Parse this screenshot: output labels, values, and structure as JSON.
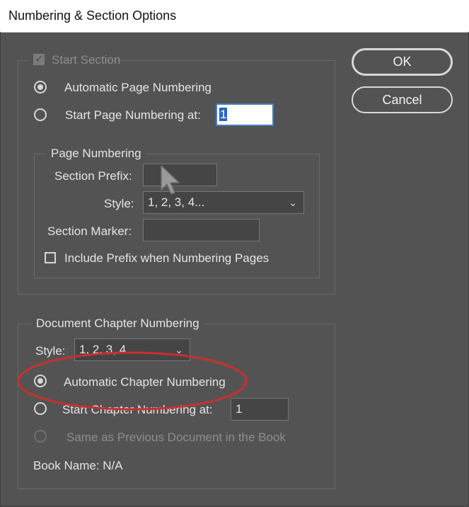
{
  "window": {
    "title": "Numbering & Section Options"
  },
  "start_section": {
    "label": "Start Section",
    "checked": true,
    "enabled": false
  },
  "page_numbering_options": {
    "automatic_label": "Automatic Page Numbering",
    "start_at_label": "Start Page Numbering at:",
    "start_at_value": "1",
    "selected": "automatic"
  },
  "page_numbering": {
    "legend": "Page Numbering",
    "section_prefix_label": "Section Prefix:",
    "section_prefix_value": "",
    "style_label": "Style:",
    "style_value": "1, 2, 3, 4...",
    "section_marker_label": "Section Marker:",
    "section_marker_value": "",
    "include_prefix_label": "Include Prefix when Numbering Pages",
    "include_prefix_checked": false
  },
  "chapter_numbering": {
    "legend": "Document Chapter Numbering",
    "style_label": "Style:",
    "style_value": "1, 2, 3, 4...",
    "automatic_label": "Automatic Chapter Numbering",
    "start_at_label": "Start Chapter Numbering at:",
    "start_at_value": "1",
    "same_as_previous_label": "Same as Previous Document in the Book",
    "book_name_label": "Book Name: N/A",
    "selected": "automatic"
  },
  "buttons": {
    "ok": "OK",
    "cancel": "Cancel"
  },
  "annotation": {
    "color": "#c9302c",
    "target": "Automatic Chapter Numbering"
  }
}
